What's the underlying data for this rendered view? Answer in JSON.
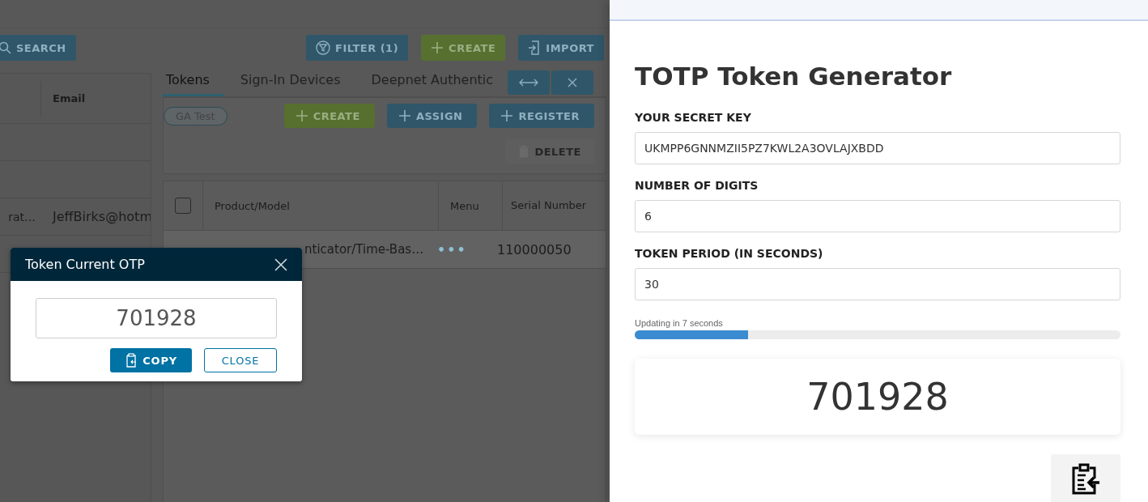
{
  "background_app": {
    "toolbar": {
      "search_button": "SEARCH",
      "buttons": [
        {
          "label": "FILTER (1)",
          "kind": "filter"
        },
        {
          "label": "CREATE",
          "kind": "create"
        },
        {
          "label": "IMPORT",
          "kind": "import"
        }
      ]
    },
    "users_table": {
      "columns": [
        "Email"
      ],
      "rows": [
        {
          "column_1": "rat…",
          "email": "JeffBirks@hotm"
        }
      ]
    },
    "tabs": [
      {
        "label": "Tokens",
        "selected": true
      },
      {
        "label": "Sign-In Devices",
        "selected": false
      },
      {
        "label": "Deepnet Authentic",
        "selected": false
      }
    ],
    "tag": "GA Test",
    "actions": [
      {
        "label": "CREATE",
        "kind": "create",
        "disabled": false
      },
      {
        "label": "ASSIGN",
        "kind": "add",
        "disabled": false
      },
      {
        "label": "REGISTER",
        "kind": "add",
        "disabled": false
      },
      {
        "label": "DELETE",
        "kind": "delete",
        "disabled": true
      }
    ],
    "tokens_table": {
      "all_checked": false,
      "columns": [
        "Product/Model",
        "Menu",
        "Serial Number"
      ],
      "rows": [
        {
          "product": "nticator/Time-Bas…",
          "menu": "•••",
          "serial": "110000050"
        }
      ]
    }
  },
  "otp_dialog": {
    "title": "Token Current OTP",
    "otp": "701928",
    "buttons": [
      {
        "label": "COPY",
        "kind": "primary"
      },
      {
        "label": "CLOSE",
        "kind": "outline"
      }
    ]
  },
  "generator": {
    "title": "TOTP Token Generator",
    "fields": [
      {
        "label": "YOUR SECRET KEY",
        "value": "UKMPP6GNNMZII5PZ7KWL2A3OVLAJXBDD"
      },
      {
        "label": "NUMBER OF DIGITS",
        "value": "6"
      },
      {
        "label": "TOKEN PERIOD (IN SECONDS)",
        "value": "30"
      }
    ],
    "countdown": "Updating in 7 seconds",
    "level": 0.233,
    "token": "701928"
  }
}
